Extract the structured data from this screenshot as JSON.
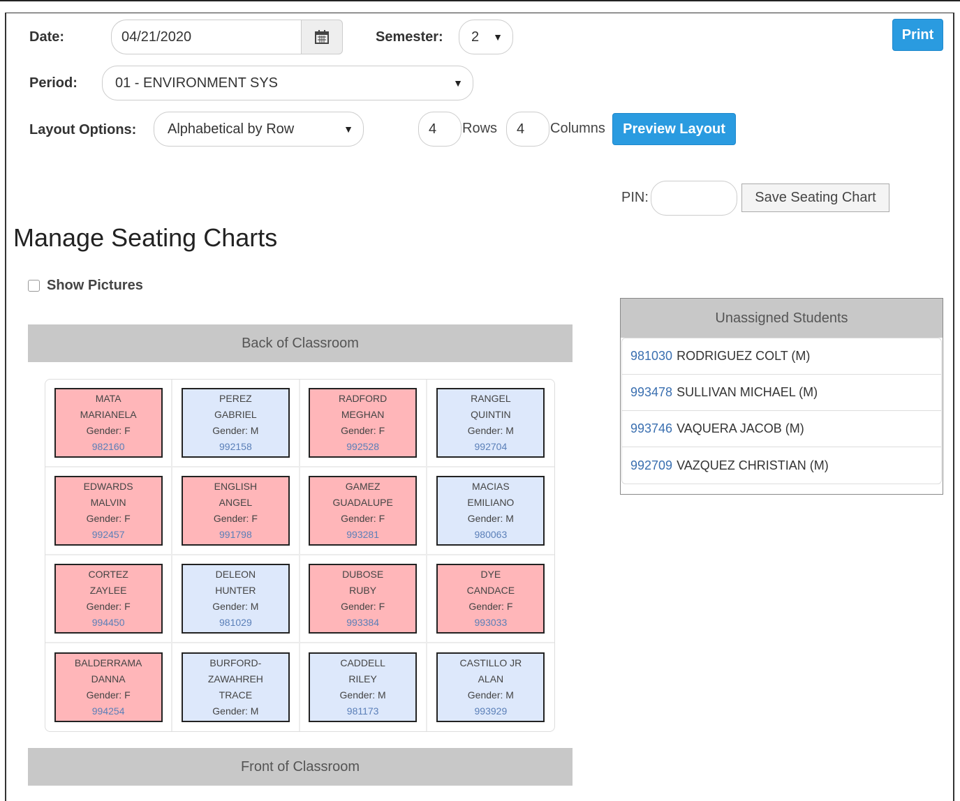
{
  "form": {
    "date_label": "Date:",
    "date_value": "04/21/2020",
    "semester_label": "Semester:",
    "semester_value": "2",
    "period_label": "Period:",
    "period_value": "01 - ENVIRONMENT SYS",
    "layout_label": "Layout Options:",
    "layout_value": "Alphabetical by Row",
    "rows_value": "4",
    "rows_label": "Rows",
    "columns_value": "4",
    "columns_label": "Columns",
    "preview_label": "Preview Layout",
    "print_label": "Print",
    "pin_label": "PIN:",
    "pin_value": "",
    "save_label": "Save Seating Chart"
  },
  "page_title": "Manage Seating Charts",
  "show_pictures_label": "Show Pictures",
  "classroom": {
    "back_label": "Back of Classroom",
    "front_label": "Front of Classroom",
    "seats": [
      {
        "last": "MATA",
        "first": "MARIANELA",
        "gender": "Gender: F",
        "id": "982160",
        "sex": "F"
      },
      {
        "last": "PEREZ",
        "first": "GABRIEL",
        "gender": "Gender: M",
        "id": "992158",
        "sex": "M"
      },
      {
        "last": "RADFORD",
        "first": "MEGHAN",
        "gender": "Gender: F",
        "id": "992528",
        "sex": "F"
      },
      {
        "last": "RANGEL",
        "first": "QUINTIN",
        "gender": "Gender: M",
        "id": "992704",
        "sex": "M"
      },
      {
        "last": "EDWARDS",
        "first": "MALVIN",
        "gender": "Gender: F",
        "id": "992457",
        "sex": "F"
      },
      {
        "last": "ENGLISH",
        "first": "ANGEL",
        "gender": "Gender: F",
        "id": "991798",
        "sex": "F"
      },
      {
        "last": "GAMEZ",
        "first": "GUADALUPE",
        "gender": "Gender: F",
        "id": "993281",
        "sex": "F"
      },
      {
        "last": "MACIAS",
        "first": "EMILIANO",
        "gender": "Gender: M",
        "id": "980063",
        "sex": "M"
      },
      {
        "last": "CORTEZ",
        "first": "ZAYLEE",
        "gender": "Gender: F",
        "id": "994450",
        "sex": "F"
      },
      {
        "last": "DELEON",
        "first": "HUNTER",
        "gender": "Gender: M",
        "id": "981029",
        "sex": "M"
      },
      {
        "last": "DUBOSE",
        "first": "RUBY",
        "gender": "Gender: F",
        "id": "993384",
        "sex": "F"
      },
      {
        "last": "DYE",
        "first": "CANDACE",
        "gender": "Gender: F",
        "id": "993033",
        "sex": "F"
      },
      {
        "last": "BALDERRAMA",
        "first": "DANNA",
        "gender": "Gender: F",
        "id": "994254",
        "sex": "F"
      },
      {
        "last": "BURFORD-",
        "first": "ZAWAHREH",
        "gender": "TRACE",
        "id": "Gender: M",
        "sex": "M",
        "id_plain": true
      },
      {
        "last": "CADDELL",
        "first": "RILEY",
        "gender": "Gender: M",
        "id": "981173",
        "sex": "M"
      },
      {
        "last": "CASTILLO JR",
        "first": "ALAN",
        "gender": "Gender: M",
        "id": "993929",
        "sex": "M"
      }
    ]
  },
  "unassigned": {
    "title": "Unassigned Students",
    "students": [
      {
        "id": "981030",
        "name": "RODRIGUEZ COLT (M)"
      },
      {
        "id": "993478",
        "name": "SULLIVAN MICHAEL (M)"
      },
      {
        "id": "993746",
        "name": "VAQUERA JACOB (M)"
      },
      {
        "id": "992709",
        "name": "VAZQUEZ CHRISTIAN (M)"
      }
    ]
  },
  "colors": {
    "female": "#ffb6b9",
    "male": "#dde8fb",
    "accent": "#2a9be0"
  }
}
